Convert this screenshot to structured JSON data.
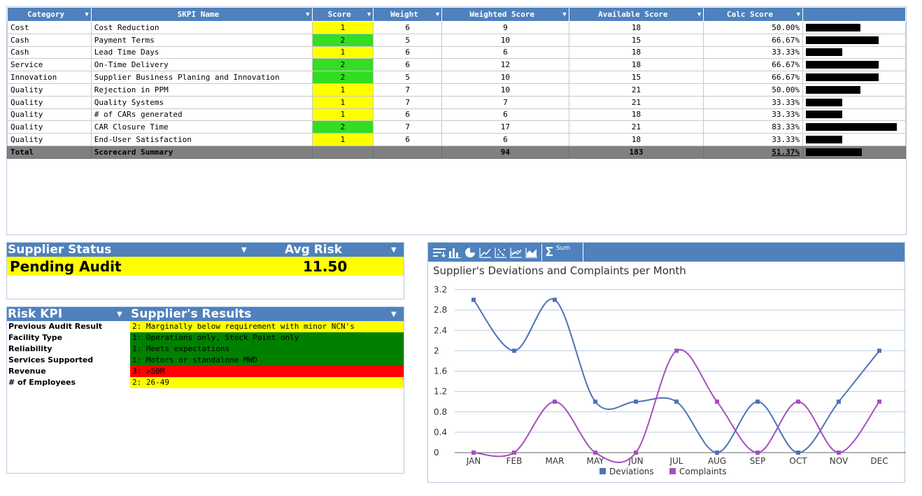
{
  "scorecard": {
    "headers": [
      "Category",
      "SKPI Name",
      "Score",
      "Weight",
      "Weighted Score",
      "Available Score",
      "Calc Score"
    ],
    "rows": [
      {
        "category": "Cost",
        "name": "Cost Reduction",
        "score": "1",
        "score_color": "yellow",
        "weight": "6",
        "weighted": "9",
        "available": "18",
        "calc": "50.00%",
        "pct": 0.5
      },
      {
        "category": "Cash",
        "name": "Payment Terms",
        "score": "2",
        "score_color": "green",
        "weight": "5",
        "weighted": "10",
        "available": "15",
        "calc": "66.67%",
        "pct": 0.6667
      },
      {
        "category": "Cash",
        "name": "Lead Time Days",
        "score": "1",
        "score_color": "yellow",
        "weight": "6",
        "weighted": "6",
        "available": "18",
        "calc": "33.33%",
        "pct": 0.3333
      },
      {
        "category": "Service",
        "name": "On-Time Delivery",
        "score": "2",
        "score_color": "green",
        "weight": "6",
        "weighted": "12",
        "available": "18",
        "calc": "66.67%",
        "pct": 0.6667
      },
      {
        "category": "Innovation",
        "name": "Supplier Business Planing and Innovation",
        "score": "2",
        "score_color": "green",
        "weight": "5",
        "weighted": "10",
        "available": "15",
        "calc": "66.67%",
        "pct": 0.6667
      },
      {
        "category": "Quality",
        "name": "Rejection in PPM",
        "score": "1",
        "score_color": "yellow",
        "weight": "7",
        "weighted": "10",
        "available": "21",
        "calc": "50.00%",
        "pct": 0.5
      },
      {
        "category": "Quality",
        "name": "Quality Systems",
        "score": "1",
        "score_color": "yellow",
        "weight": "7",
        "weighted": "7",
        "available": "21",
        "calc": "33.33%",
        "pct": 0.3333
      },
      {
        "category": "Quality",
        "name": "# of CARs generated",
        "score": "1",
        "score_color": "yellow",
        "weight": "6",
        "weighted": "6",
        "available": "18",
        "calc": "33.33%",
        "pct": 0.3333
      },
      {
        "category": "Quality",
        "name": "CAR Closure Time",
        "score": "2",
        "score_color": "green",
        "weight": "7",
        "weighted": "17",
        "available": "21",
        "calc": "83.33%",
        "pct": 0.8333
      },
      {
        "category": "Quality",
        "name": "End-User Satisfaction",
        "score": "1",
        "score_color": "yellow",
        "weight": "6",
        "weighted": "6",
        "available": "18",
        "calc": "33.33%",
        "pct": 0.3333
      }
    ],
    "total": {
      "category": "Total",
      "name": "Scorecard Summary",
      "weighted": "94",
      "available": "183",
      "calc": "51.37%",
      "pct": 0.5137
    }
  },
  "supplier_status": {
    "header_left": "Supplier Status",
    "header_right": "Avg Risk",
    "status_value": "Pending Audit",
    "avg_risk_value": "11.50"
  },
  "risk": {
    "header_left": "Risk KPI",
    "header_right": "Supplier's Results",
    "rows": [
      {
        "label": "Previous Audit Result",
        "value": "2: Marginally below requirement with minor NCN's",
        "color": "yellow"
      },
      {
        "label": "Facility Type",
        "value": "1: Operations only, Stock Point only",
        "color": "green"
      },
      {
        "label": "Reliability",
        "value": "1: Meets expectations",
        "color": "green"
      },
      {
        "label": "Services Supported",
        "value": "1: Motors or standalone MWD",
        "color": "green"
      },
      {
        "label": "Revenue",
        "value": "3: >50M",
        "color": "red"
      },
      {
        "label": "# of Employees",
        "value": "2: 26-49",
        "color": "yellow"
      }
    ]
  },
  "chart_toolbar": {
    "icons": [
      "sort-icon",
      "bar-chart-icon",
      "pie-chart-icon",
      "line-chart-icon",
      "scatter-chart-icon",
      "multi-line-chart-icon",
      "area-chart-icon"
    ],
    "sum_label": "Sum"
  },
  "chart_data": {
    "type": "line",
    "title": "Supplier's Deviations and Complaints per Month",
    "categories": [
      "JAN",
      "FEB",
      "MAR",
      "MAY",
      "JUN",
      "JUL",
      "AUG",
      "SEP",
      "OCT",
      "NOV",
      "DEC"
    ],
    "series": [
      {
        "name": "Deviations",
        "color": "#4f72b5",
        "values": [
          3,
          2,
          3,
          1,
          1,
          1,
          0,
          1,
          0,
          1,
          2
        ]
      },
      {
        "name": "Complaints",
        "color": "#a64fbf",
        "values": [
          0,
          0,
          1,
          0,
          0,
          2,
          1,
          0,
          1,
          0,
          1
        ]
      }
    ],
    "ylim": [
      0,
      3.2
    ],
    "yticks": [
      "0",
      "0.4",
      "0.8",
      "1.2",
      "1.6",
      "2",
      "2.4",
      "2.8",
      "3.2"
    ],
    "grid": true,
    "legend": "bottom"
  }
}
